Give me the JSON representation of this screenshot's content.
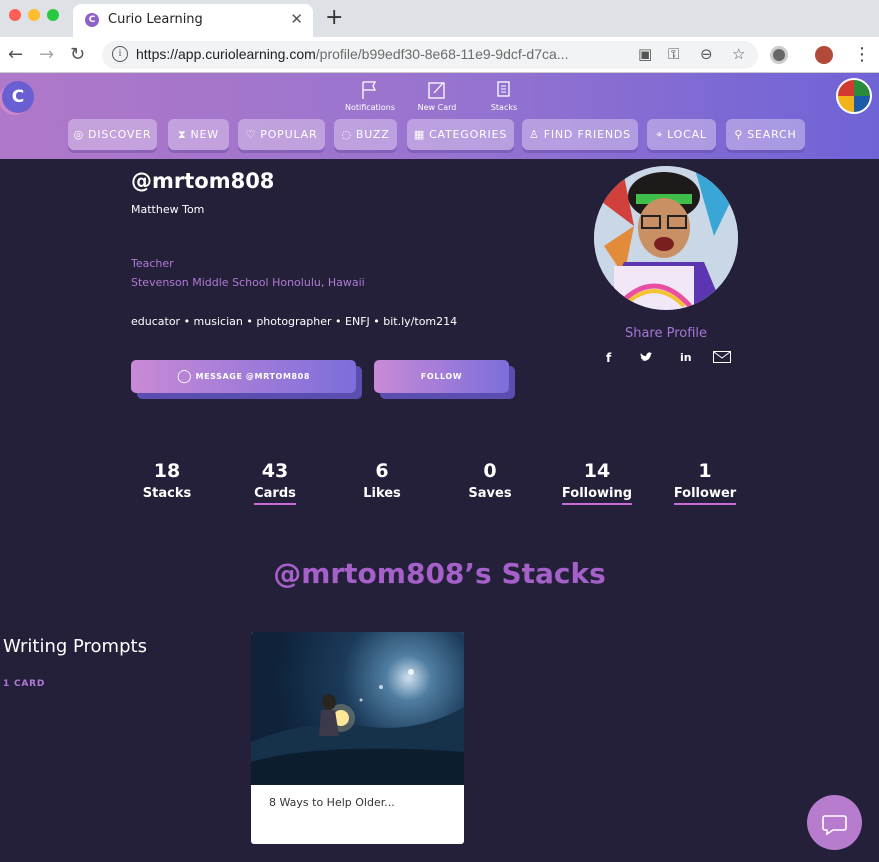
{
  "browser": {
    "tab_title": "Curio Learning",
    "tab_icon": "C",
    "url_host": "https://app.curiolearning.com",
    "url_path": "/profile/b99edf30-8e68-11e9-9dcf-d7ca..."
  },
  "header": {
    "logo_letter": "C",
    "top_icons": [
      {
        "label": "Notifications",
        "icon": "flag-icon"
      },
      {
        "label": "New Card",
        "icon": "edit-icon"
      },
      {
        "label": "Stacks",
        "icon": "stacks-icon"
      }
    ],
    "nav": [
      {
        "label": "DISCOVER",
        "icon": "compass-icon",
        "glyph": "◎"
      },
      {
        "label": "NEW",
        "icon": "hourglass-icon",
        "glyph": "⧗"
      },
      {
        "label": "POPULAR",
        "icon": "heart-icon",
        "glyph": "♡"
      },
      {
        "label": "BUZZ",
        "icon": "chat-icon",
        "glyph": "◌"
      },
      {
        "label": "CATEGORIES",
        "icon": "grid-icon",
        "glyph": "▦"
      },
      {
        "label": "FIND FRIENDS",
        "icon": "people-icon",
        "glyph": "♙"
      },
      {
        "label": "LOCAL",
        "icon": "pin-icon",
        "glyph": "⌖"
      },
      {
        "label": "SEARCH",
        "icon": "search-icon",
        "glyph": "⚲"
      }
    ]
  },
  "profile": {
    "handle": "@mrtom808",
    "name": "Matthew Tom",
    "role": "Teacher",
    "school": "Stevenson Middle School Honolulu, Hawaii",
    "bio": "educator • musician • photographer • ENFJ • bit.ly/tom214",
    "message_label": "MESSAGE @MRTOM808",
    "follow_label": "FOLLOW",
    "share_label": "Share Profile"
  },
  "stats": [
    {
      "value": "18",
      "label": "Stacks",
      "underlined": false
    },
    {
      "value": "43",
      "label": "Cards",
      "underlined": true
    },
    {
      "value": "6",
      "label": "Likes",
      "underlined": false
    },
    {
      "value": "0",
      "label": "Saves",
      "underlined": false
    },
    {
      "value": "14",
      "label": "Following",
      "underlined": true
    },
    {
      "value": "1",
      "label": "Follower",
      "underlined": true
    }
  ],
  "stacks": {
    "title": "@mrtom808’s Stacks",
    "items": [
      {
        "name": "Writing Prompts",
        "count": "1 CARD",
        "card_title": "8 Ways to Help Older..."
      }
    ]
  },
  "colors": {
    "accent": "#a561c9",
    "background": "#24203a",
    "underline": "#c86cd6"
  }
}
